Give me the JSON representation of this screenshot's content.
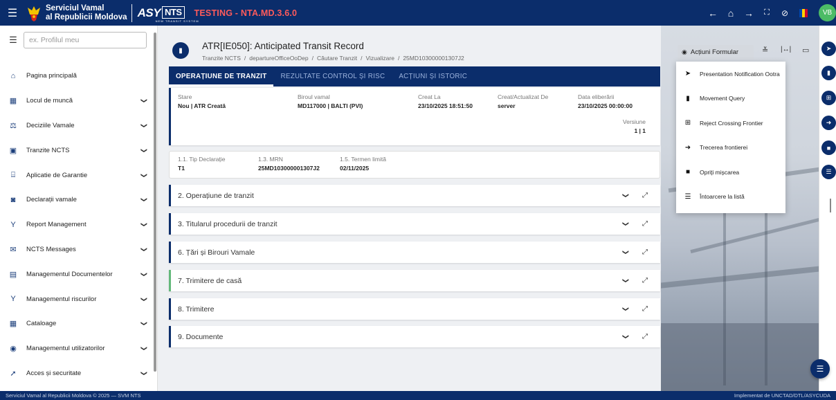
{
  "topbar": {
    "brand_line1": "Serviciul Vamal",
    "brand_line2": "al Republicii Moldova",
    "logo_asy": "ASY",
    "logo_nts": "NTS",
    "logo_sub": "NEW TRANSIT SYSTEM",
    "environment": "TESTING - NTA.MD.3.6.0",
    "avatar_initials": "VB",
    "env_color": "#ff5b5b",
    "brand_color": "#0b2d6b"
  },
  "sidebar": {
    "search_placeholder": "ex. Profilul meu",
    "items": [
      {
        "label": "Pagina principală",
        "icon": "home-icon",
        "glyph": "⌂",
        "has_chevron": false
      },
      {
        "label": "Locul de muncă",
        "icon": "workplace-icon",
        "glyph": "▦",
        "has_chevron": true
      },
      {
        "label": "Deciziile Vamale",
        "icon": "scale-icon",
        "glyph": "⚖",
        "has_chevron": true
      },
      {
        "label": "Tranzite NCTS",
        "icon": "bus-icon",
        "glyph": "▣",
        "has_chevron": true
      },
      {
        "label": "Aplicatie de Garantie",
        "icon": "bank-icon",
        "glyph": "⌸",
        "has_chevron": true
      },
      {
        "label": "Declarații vamale",
        "icon": "declaration-icon",
        "glyph": "◙",
        "has_chevron": true
      },
      {
        "label": "Report Management",
        "icon": "report-icon",
        "glyph": "Y",
        "has_chevron": true
      },
      {
        "label": "NCTS Messages",
        "icon": "envelope-icon",
        "glyph": "✉",
        "has_chevron": true
      },
      {
        "label": "Managementul Documentelor",
        "icon": "document-icon",
        "glyph": "▤",
        "has_chevron": true
      },
      {
        "label": "Managementul riscurilor",
        "icon": "risk-icon",
        "glyph": "Y",
        "has_chevron": true
      },
      {
        "label": "Cataloage",
        "icon": "catalog-icon",
        "glyph": "▦",
        "has_chevron": true
      },
      {
        "label": "Managementul utilizatorilor",
        "icon": "user-shield-icon",
        "glyph": "◉",
        "has_chevron": true
      },
      {
        "label": "Acces și securitate",
        "icon": "key-icon",
        "glyph": "➚",
        "has_chevron": true
      }
    ]
  },
  "record": {
    "title": "ATR[IE050]: Anticipated Transit Record",
    "breadcrumb": [
      "Tranzite NCTS",
      "departureOfficeOoDep",
      "Căutare Tranzit",
      "Vizualizare",
      "25MD103000001307J2"
    ]
  },
  "tabs": [
    {
      "label": "OPERAȚIUNE DE TRANZIT",
      "active": true
    },
    {
      "label": "REZULTATE CONTROL ȘI RISC",
      "active": false
    },
    {
      "label": "ACȚIUNI ȘI ISTORIC",
      "active": false
    }
  ],
  "info": {
    "stare_label": "Stare",
    "stare_value": "Nou | ATR Creată",
    "birou_label": "Biroul vamal",
    "birou_value": "MD117000 | BALTI (PVI)",
    "creat_label": "Creat La",
    "creat_value": "23/10/2025 18:51:50",
    "actualizat_label": "Creat/Actualizat De",
    "actualizat_value": "server",
    "eliberare_label": "Data eliberării",
    "eliberare_value": "23/10/2025 00:00:00",
    "versiune_label": "Versiune",
    "versiune_value": "1 | 1"
  },
  "declaration": {
    "tip_label": "1.1. Tip Declarație",
    "tip_value": "T1",
    "mrn_label": "1.3. MRN",
    "mrn_value": "25MD103000001307J2",
    "termen_label": "1.5. Termen limită",
    "termen_value": "02/11/2025"
  },
  "sections": [
    {
      "title": "2. Operațiune de tranzit",
      "accent": "blue"
    },
    {
      "title": "3. Titularul procedurii de tranzit",
      "accent": "blue"
    },
    {
      "title": "6. Țări și Birouri Vamale",
      "accent": "blue"
    },
    {
      "title": "7. Trimitere de casă",
      "accent": "green"
    },
    {
      "title": "8. Trimitere",
      "accent": "blue"
    },
    {
      "title": "9. Documente",
      "accent": "blue"
    }
  ],
  "actions": {
    "button_label": "Acțiuni Formular",
    "items": [
      {
        "label": "Presentation Notification Ootra",
        "icon": "send-icon",
        "glyph": "➤"
      },
      {
        "label": "Movement Query",
        "icon": "file-query-icon",
        "glyph": "▮"
      },
      {
        "label": "Reject Crossing Frontier",
        "icon": "barrier-icon",
        "glyph": "⊞"
      },
      {
        "label": "Trecerea frontierei",
        "icon": "arrow-right-icon",
        "glyph": "➜"
      },
      {
        "label": "Opriți mișcarea",
        "icon": "stop-icon",
        "glyph": "■"
      },
      {
        "label": "Întoarcere la listă",
        "icon": "list-icon",
        "glyph": "☰"
      }
    ]
  },
  "footer": {
    "left": "Serviciul Vamal al Republicii Moldova © 2025 — SVM NTS",
    "right": "Implementat de UNCTAD/DTL/ASYCUDA"
  }
}
